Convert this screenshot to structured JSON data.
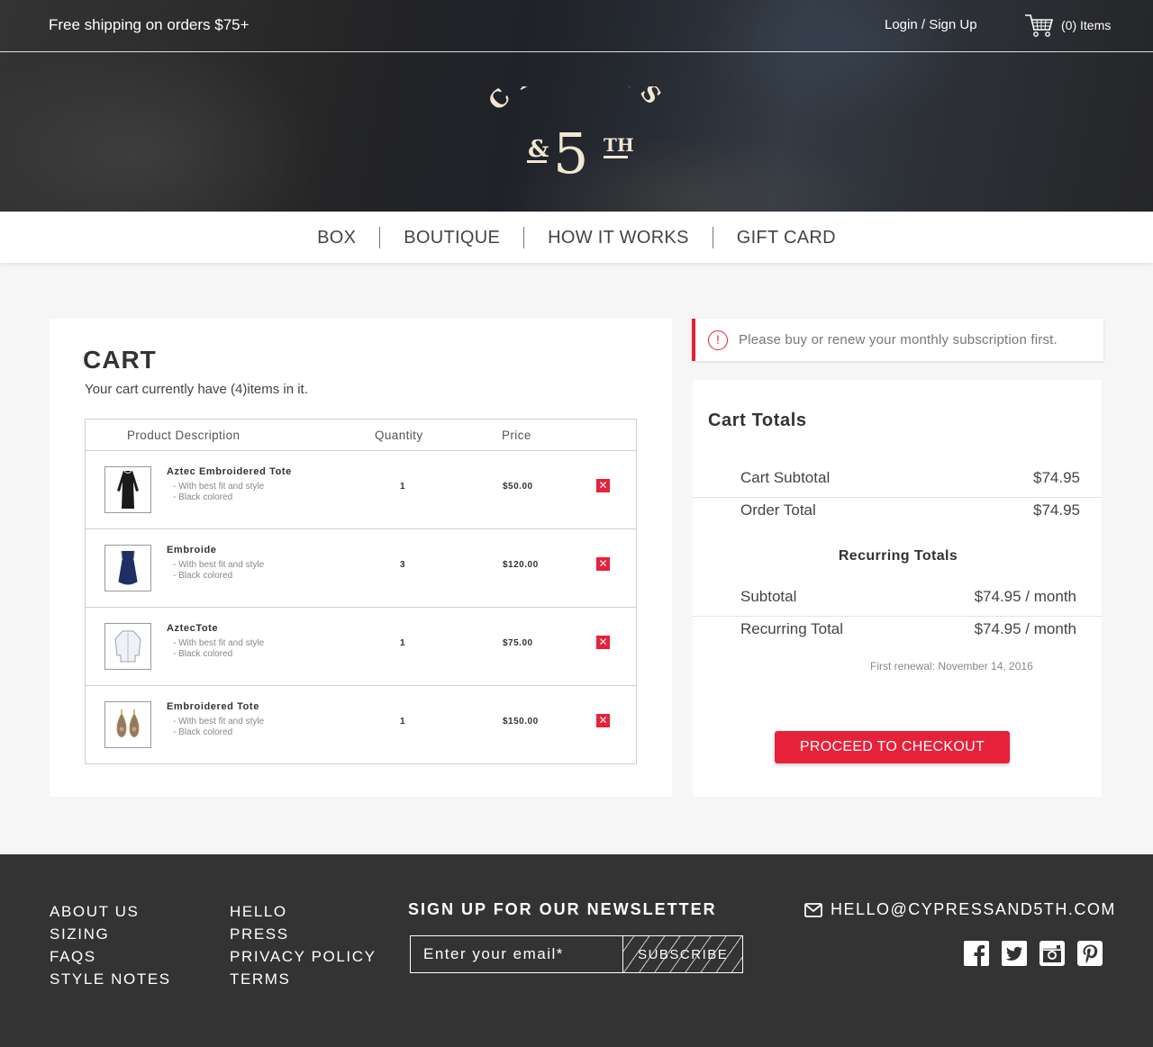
{
  "header": {
    "promo": "Free shipping on orders $75+",
    "login": "Login / Sign Up",
    "cart_count": "(0) Items",
    "logo": {
      "line1": "CYPRESS",
      "amp": "&",
      "num": "5",
      "sup": "TH"
    }
  },
  "nav": {
    "items": [
      "BOX",
      "BOUTIQUE",
      "HOW IT WORKS",
      "GIFT CARD"
    ]
  },
  "cart": {
    "title": "CART",
    "subtitle": "Your cart currently have (4)items in it.",
    "columns": {
      "product": "Product Description",
      "quantity": "Quantity",
      "price": "Price"
    },
    "items": [
      {
        "name": "Aztec Embroidered Tote",
        "desc1": "- With best fit and style",
        "desc2": "- Black colored",
        "qty": "1",
        "price": "$50.00",
        "thumb": "dress-icon"
      },
      {
        "name": "Embroide",
        "desc1": "- With best fit and style",
        "desc2": "- Black colored",
        "qty": "3",
        "price": "$120.00",
        "thumb": "camisole-icon"
      },
      {
        "name": "AztecTote",
        "desc1": "- With best fit and style",
        "desc2": "- Black colored",
        "qty": "1",
        "price": "$75.00",
        "thumb": "blouse-icon"
      },
      {
        "name": "Embroidered Tote",
        "desc1": "- With best fit and style",
        "desc2": "- Black colored",
        "qty": "1",
        "price": "$150.00",
        "thumb": "earrings-icon"
      }
    ],
    "remove_glyph": "✕"
  },
  "alert": {
    "icon": "!",
    "text": "Please buy or renew your monthly subscription first."
  },
  "totals": {
    "title": "Cart Totals",
    "subtotal_label": "Cart Subtotal",
    "subtotal_value": "$74.95",
    "order_total_label": "Order Total",
    "order_total_value": "$74.95",
    "recurring_title": "Recurring Totals",
    "rec_subtotal_label": "Subtotal",
    "rec_subtotal_value": "$74.95 / month",
    "rec_total_label": "Recurring Total",
    "rec_total_value": "$74.95 / month",
    "renewal": "First renewal: November 14, 2016",
    "checkout": "PROCEED TO CHECKOUT"
  },
  "footer": {
    "col1": [
      "ABOUT US",
      "SIZING",
      "FAQS",
      "STYLE NOTES"
    ],
    "col2": [
      "HELLO",
      "PRESS",
      "PRIVACY POLICY",
      "TERMS"
    ],
    "newsletter_title": "SIGN UP FOR OUR NEWSLETTER",
    "newsletter_placeholder": "Enter your email*",
    "subscribe": "SUBSCRIBE",
    "email": "HELLO@CYPRESSAND5TH.COM",
    "socials": [
      "facebook-icon",
      "twitter-icon",
      "instagram-icon",
      "pinterest-icon"
    ]
  },
  "colors": {
    "accent": "#e8213a",
    "footer_bg": "#333333",
    "logo": "#f3e6d3"
  }
}
